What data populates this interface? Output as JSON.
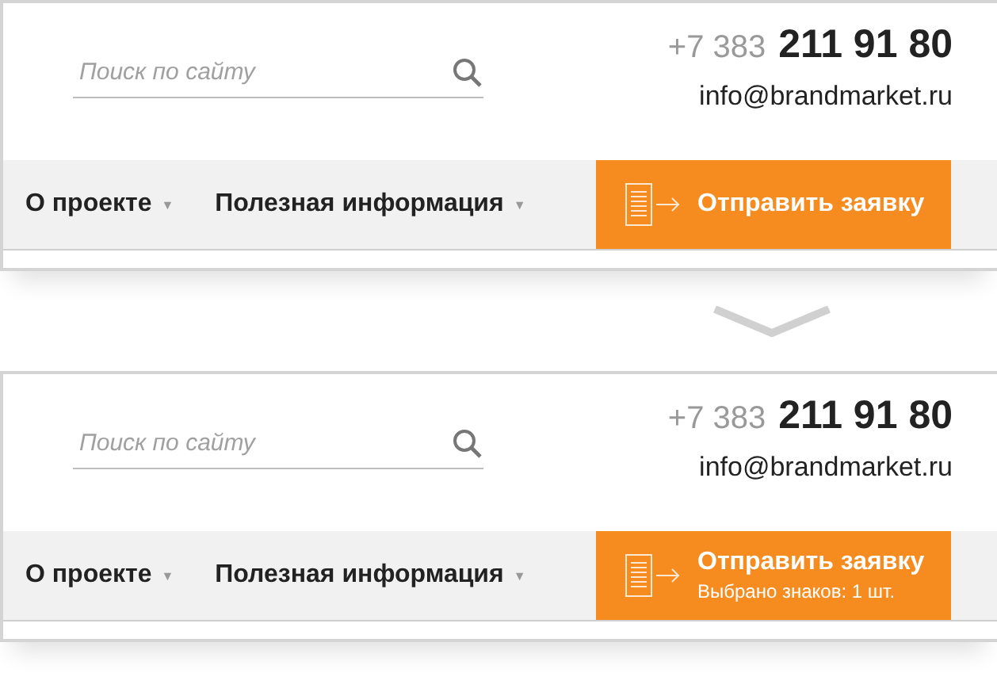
{
  "panels": [
    {
      "search": {
        "placeholder": "Поиск по сайту"
      },
      "phone_code": "+7 383",
      "phone_number": "211 91 80",
      "email": "info@brandmarket.ru",
      "nav": [
        {
          "label": "О проекте",
          "caret": "▼"
        },
        {
          "label": "Полезная информация",
          "caret": "▼"
        }
      ],
      "cta": {
        "label": "Отправить заявку"
      }
    },
    {
      "search": {
        "placeholder": "Поиск по сайту"
      },
      "phone_code": "+7 383",
      "phone_number": "211 91 80",
      "email": "info@brandmarket.ru",
      "nav": [
        {
          "label": "О проекте",
          "caret": "▼"
        },
        {
          "label": "Полезная информация",
          "caret": "▼"
        }
      ],
      "cta": {
        "label": "Отправить заявку",
        "subtitle": "Выбрано знаков: 1 шт."
      }
    }
  ]
}
